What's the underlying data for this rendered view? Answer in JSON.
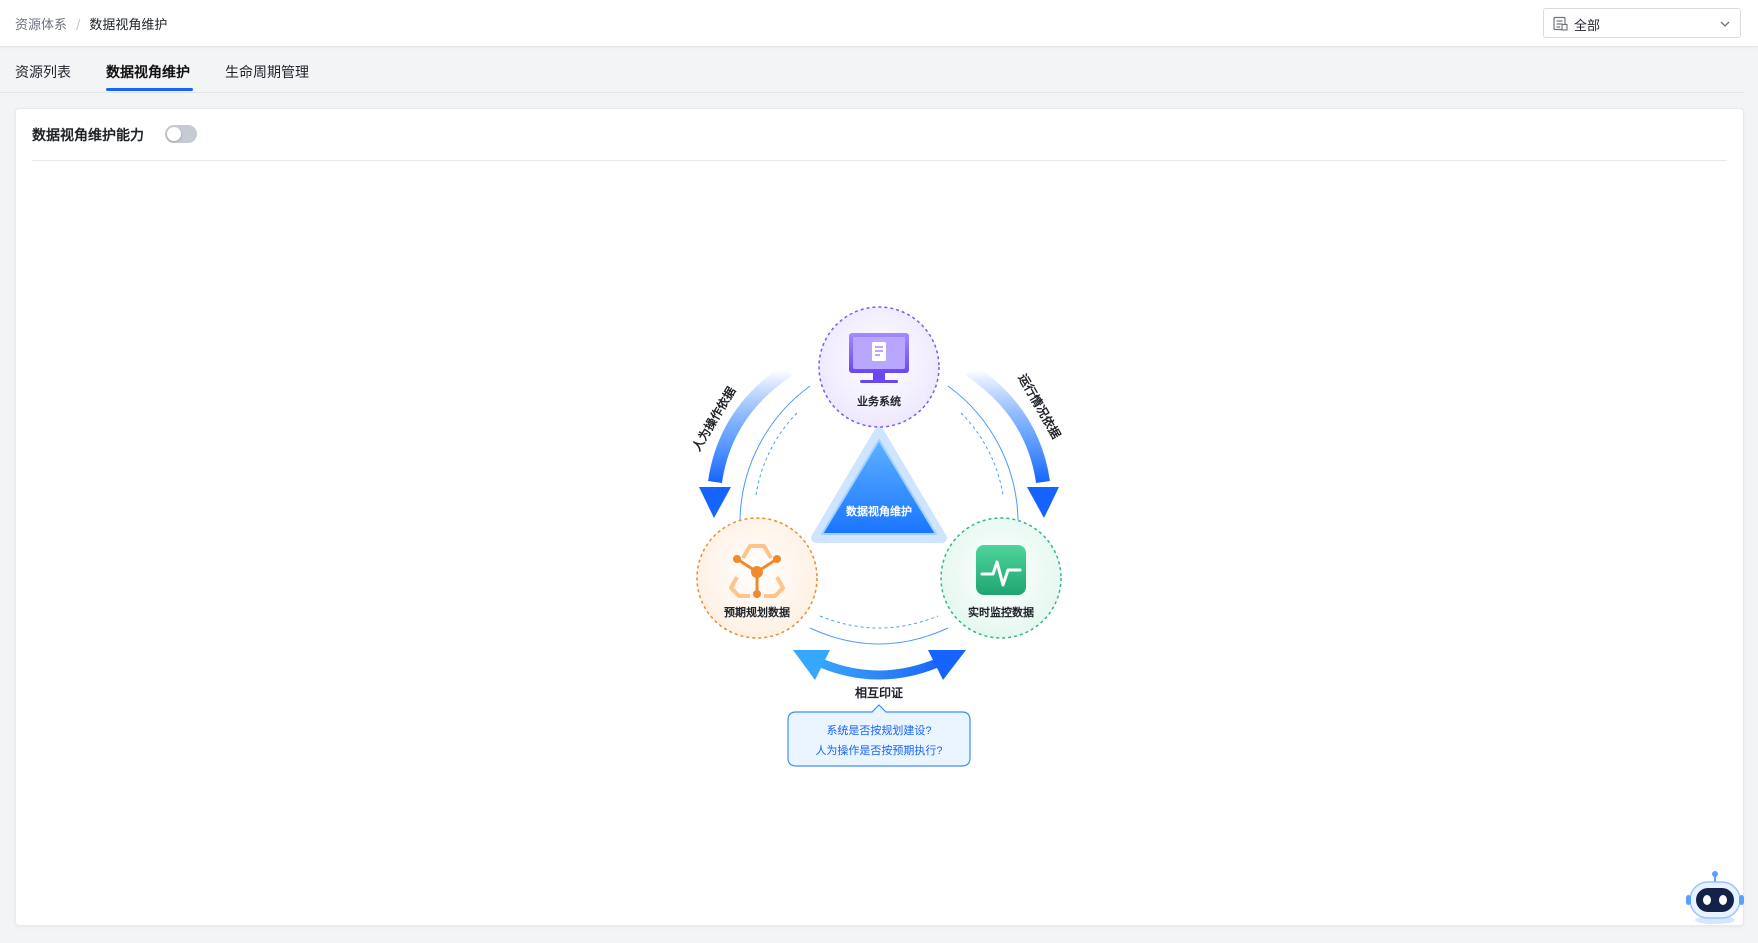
{
  "breadcrumb": {
    "root": "资源体系",
    "separator": "/",
    "current": "数据视角维护"
  },
  "scope_select": {
    "value": "全部",
    "icon": "list-filter-icon"
  },
  "tabs": [
    {
      "label": "资源列表",
      "active": false
    },
    {
      "label": "数据视角维护",
      "active": true
    },
    {
      "label": "生命周期管理",
      "active": false
    }
  ],
  "panel": {
    "title": "数据视角维护能力",
    "toggle_on": false
  },
  "diagram": {
    "center_label": "数据视角维护",
    "nodes": {
      "business": {
        "label": "业务系统",
        "icon": "monitor-document-icon",
        "color": "#7b5cf0"
      },
      "planned": {
        "label": "预期规划数据",
        "icon": "network-nodes-icon",
        "color": "#f08a2c"
      },
      "realtime": {
        "label": "实时监控数据",
        "icon": "pulse-monitor-icon",
        "color": "#2dbb83"
      }
    },
    "left_arrow_label": "人为操作依据",
    "right_arrow_label": "运行情况依据",
    "bottom_arrow_label": "相互印证",
    "callout": {
      "line1": "系统是否按规划建设?",
      "line2": "人为操作是否按预期执行?"
    },
    "accent": "#1664ff"
  },
  "assistant": {
    "icon": "robot-assistant-icon"
  }
}
